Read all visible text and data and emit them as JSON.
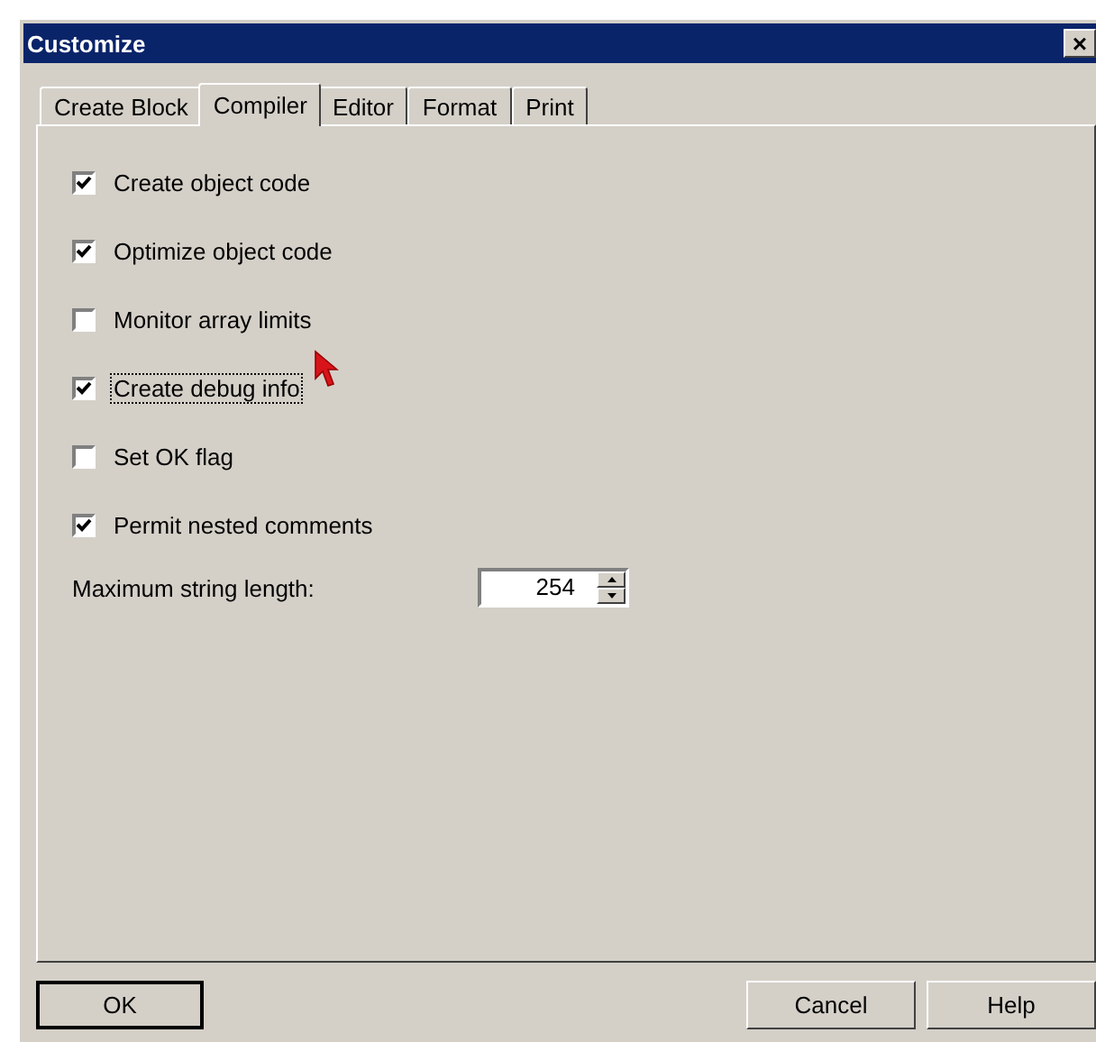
{
  "window": {
    "title": "Customize",
    "close": "×"
  },
  "tabs": [
    {
      "label": "Create Block",
      "selected": false
    },
    {
      "label": "Compiler",
      "selected": true
    },
    {
      "label": "Editor",
      "selected": false
    },
    {
      "label": "Format",
      "selected": false
    },
    {
      "label": "Print",
      "selected": false
    }
  ],
  "options": [
    {
      "label": "Create object code",
      "checked": true,
      "focused": false
    },
    {
      "label": "Optimize object code",
      "checked": true,
      "focused": false
    },
    {
      "label": "Monitor array limits",
      "checked": false,
      "focused": false
    },
    {
      "label": "Create debug info",
      "checked": true,
      "focused": true
    },
    {
      "label": "Set OK flag",
      "checked": false,
      "focused": false
    },
    {
      "label": "Permit nested comments",
      "checked": true,
      "focused": false
    }
  ],
  "max_string_length": {
    "label": "Maximum string length:",
    "value": "254"
  },
  "buttons": [
    {
      "label": "OK",
      "default": true
    },
    {
      "label": "Cancel",
      "default": false
    },
    {
      "label": "Help",
      "default": false
    }
  ]
}
